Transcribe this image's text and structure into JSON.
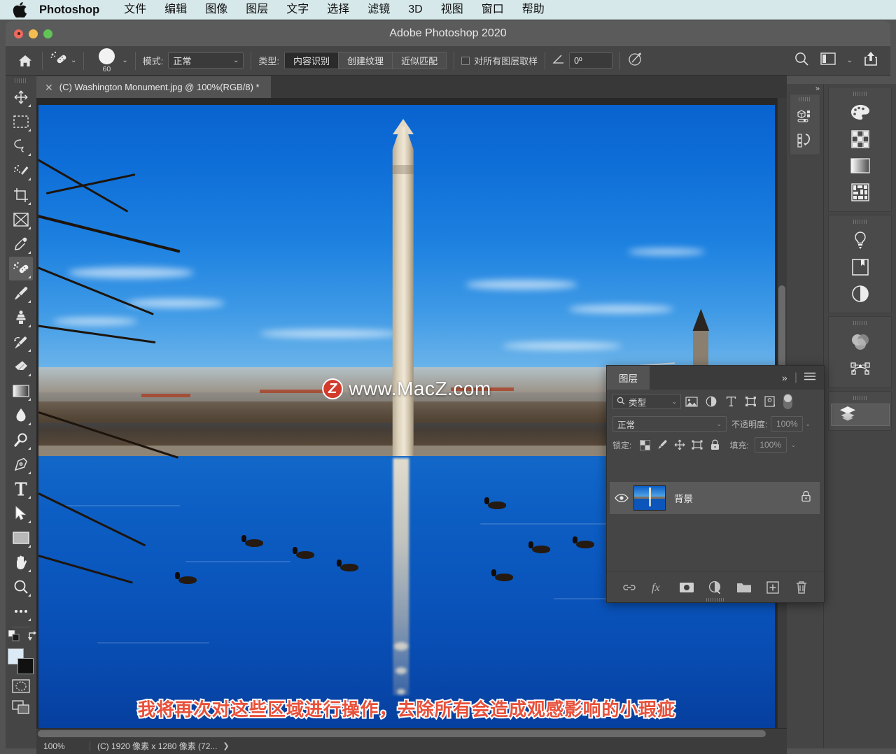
{
  "menubar": {
    "apple_icon": "apple-logo",
    "app_name": "Photoshop",
    "items": [
      "文件",
      "编辑",
      "图像",
      "图层",
      "文字",
      "选择",
      "滤镜",
      "3D",
      "视图",
      "窗口",
      "帮助"
    ]
  },
  "window": {
    "title": "Adobe Photoshop 2020"
  },
  "options_bar": {
    "home_icon": "home-icon",
    "tool_preset_icon": "spot-healing-brush-icon",
    "brush_size": "60",
    "mode_label": "模式:",
    "mode_value": "正常",
    "type_label": "类型:",
    "type_buttons": [
      {
        "label": "内容识别",
        "active": true
      },
      {
        "label": "创建纹理",
        "active": false
      },
      {
        "label": "近似匹配",
        "active": false
      }
    ],
    "sample_all_layers_label": "对所有图层取样",
    "sample_all_layers_checked": false,
    "angle_icon": "angle-icon",
    "angle_value": "0º",
    "pressure_icon": "pressure-for-size-icon",
    "search_icon": "search-icon",
    "workspace_icon": "workspace-icon",
    "workspace_chevron": "chevron-down-icon",
    "share_icon": "share-icon"
  },
  "toolbar": {
    "tools": [
      {
        "name": "move-tool",
        "selected": false
      },
      {
        "name": "rectangular-marquee-tool",
        "selected": false
      },
      {
        "name": "lasso-tool",
        "selected": false
      },
      {
        "name": "quick-selection-tool",
        "selected": false
      },
      {
        "name": "crop-tool",
        "selected": false
      },
      {
        "name": "frame-tool",
        "selected": false
      },
      {
        "name": "eyedropper-tool",
        "selected": false
      },
      {
        "name": "spot-healing-brush-tool",
        "selected": true
      },
      {
        "name": "brush-tool",
        "selected": false
      },
      {
        "name": "clone-stamp-tool",
        "selected": false
      },
      {
        "name": "history-brush-tool",
        "selected": false
      },
      {
        "name": "eraser-tool",
        "selected": false
      },
      {
        "name": "gradient-tool",
        "selected": false
      },
      {
        "name": "blur-tool",
        "selected": false
      },
      {
        "name": "dodge-tool",
        "selected": false
      },
      {
        "name": "pen-tool",
        "selected": false
      },
      {
        "name": "type-tool",
        "selected": false
      },
      {
        "name": "path-selection-tool",
        "selected": false
      },
      {
        "name": "rectangle-tool",
        "selected": false
      },
      {
        "name": "hand-tool",
        "selected": false
      },
      {
        "name": "zoom-tool",
        "selected": false
      },
      {
        "name": "edit-toolbar-tool",
        "selected": false
      }
    ],
    "foreground_color": "#dbeaf5",
    "background_color": "#111111",
    "swap_colors_icon": "swap-colors-icon",
    "default_colors_icon": "default-colors-icon",
    "quick_mask_icon": "quick-mask-icon",
    "screen_mode_icon": "screen-mode-icon"
  },
  "document_tab": {
    "close_icon": "close-icon",
    "title": "(C) Washington Monument.jpg @ 100%(RGB/8) *"
  },
  "canvas": {
    "watermark_badge": "Z",
    "watermark_text": "www.MacZ.com",
    "caption": "我将再次对这些区域进行操作，去除所有会造成观感影响的小瑕疵"
  },
  "status_bar": {
    "zoom": "100%",
    "doc_info": "(C) 1920 像素 x 1280 像素 (72...",
    "arrow_icon": "chevron-right-icon"
  },
  "dock_narrow": {
    "collapse_icon": "double-chevron-right-icon",
    "icons": [
      "3d-properties-icon",
      "history-icon"
    ]
  },
  "dock_icons": {
    "group1": [
      "color-swatches-icon",
      "pattern-grid-icon",
      "gradients-icon",
      "patterns-icon"
    ],
    "group2": [
      "adjustments-icon",
      "libraries-icon",
      "adjustment-layer-icon"
    ],
    "group3": [
      "channels-icon",
      "paths-icon"
    ],
    "layers_button_icon": "layers-icon"
  },
  "layers_panel": {
    "tab_label": "图层",
    "collapse_icon": "double-chevron-right-icon",
    "menu_icon": "panel-menu-icon",
    "filter": {
      "search_icon": "search-icon",
      "value": "类型",
      "chevron": "chevron-down-icon",
      "icons": [
        "filter-pixel-icon",
        "filter-adjustment-icon",
        "filter-type-icon",
        "filter-shape-icon",
        "filter-smart-object-icon"
      ],
      "toggle": "filter-enable-toggle"
    },
    "blend_mode": "正常",
    "opacity_label": "不透明度:",
    "opacity_value": "100%",
    "lock_label": "锁定:",
    "lock_icons": [
      "lock-transparent-pixels-icon",
      "lock-image-pixels-icon",
      "lock-position-icon",
      "lock-artboard-icon",
      "lock-all-icon"
    ],
    "fill_label": "填充:",
    "fill_value": "100%",
    "layers": [
      {
        "name": "背景",
        "visible": true,
        "locked": true,
        "eye_icon": "eye-icon",
        "lock_icon": "lock-icon",
        "thumbnail": "layer-thumbnail"
      }
    ],
    "footer_icons": [
      "link-layers-icon",
      "layer-style-fx-icon",
      "layer-mask-icon",
      "new-adjustment-layer-icon",
      "new-group-icon",
      "new-layer-icon",
      "delete-layer-icon"
    ]
  }
}
